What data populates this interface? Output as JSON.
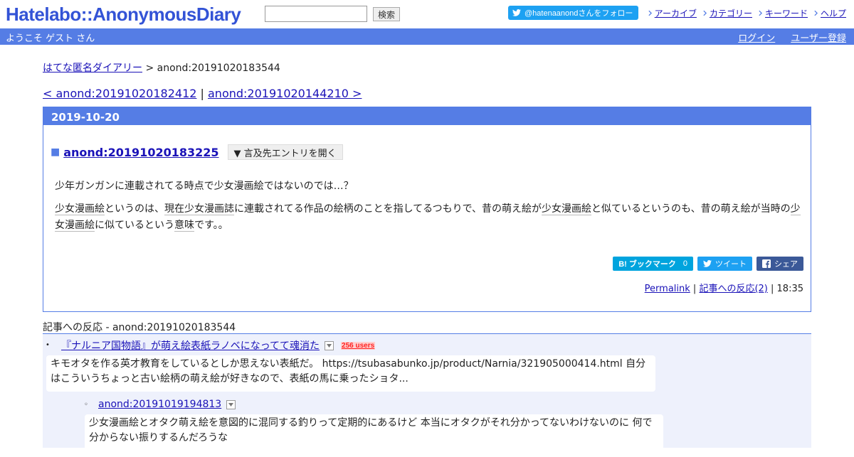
{
  "header": {
    "logo": "Hatelabo::AnonymousDiary",
    "search_placeholder": "",
    "search_button": "検索",
    "follow_label": "@hatenaanondさんをフォロー",
    "nav": [
      "アーカイブ",
      "カテゴリー",
      "キーワード",
      "ヘルプ"
    ]
  },
  "subbar": {
    "welcome": "ようこそ ゲスト さん",
    "login": "ログイン",
    "register": "ユーザー登録"
  },
  "breadcrumb": {
    "home": "はてな匿名ダイアリー",
    "separator": " > ",
    "current": "anond:20191020183544"
  },
  "pager": {
    "prev": "< anond:20191020182412",
    "separator": " | ",
    "next": "anond:20191020144210 >"
  },
  "day": {
    "date": "2019-10-20",
    "entry": {
      "bullet": "■",
      "title": "anond:20191020183225",
      "ref_toggle": "▼ 言及先エントリを開く",
      "p1": "少年ガンガンに連載されてる時点で少女漫画絵ではないのでは…？",
      "p2_parts": [
        "",
        "少女漫画絵",
        "というのは、",
        "現在",
        "",
        "少女漫画誌",
        "に連載されてる作品の絵柄のことを指してるつもりで、昔の萌え絵が",
        "少女漫画絵",
        "と似ているというのも、昔の萌え絵が当時の",
        "少女漫画絵",
        "に似ているという",
        "意味",
        "です。。"
      ],
      "bookmark_label": "B! ブックマーク",
      "bookmark_count": "0",
      "tweet_label": "ツイート",
      "share_label": "シェア",
      "permalink": "Permalink",
      "sep": " | ",
      "reactions_link": "記事への反応(2)",
      "time": "18:35"
    }
  },
  "refs": {
    "heading": "記事への反応 - anond:20191020183544",
    "items": [
      {
        "bullet": "•",
        "title": "『ナルニア国物語』が萌え絵表紙ラノベになってて魂消た",
        "users": "256 users",
        "summary": "キモオタを作る英才教育をしているとしか思えない表紙だ。 https://tsubasabunko.jp/product/Narnia/321905000414.html 自分はこういうちょっと古い絵柄の萌え絵が好きなので、表紙の馬に乗ったショタ..."
      },
      {
        "bullet": "◦",
        "title": "anond:20191019194813",
        "summary": "少女漫画絵とオタク萌え絵を意図的に混同する釣りって定期的にあるけど 本当にオタクがそれ分かってないわけないのに 何で分からない振りするんだろうな"
      }
    ]
  }
}
